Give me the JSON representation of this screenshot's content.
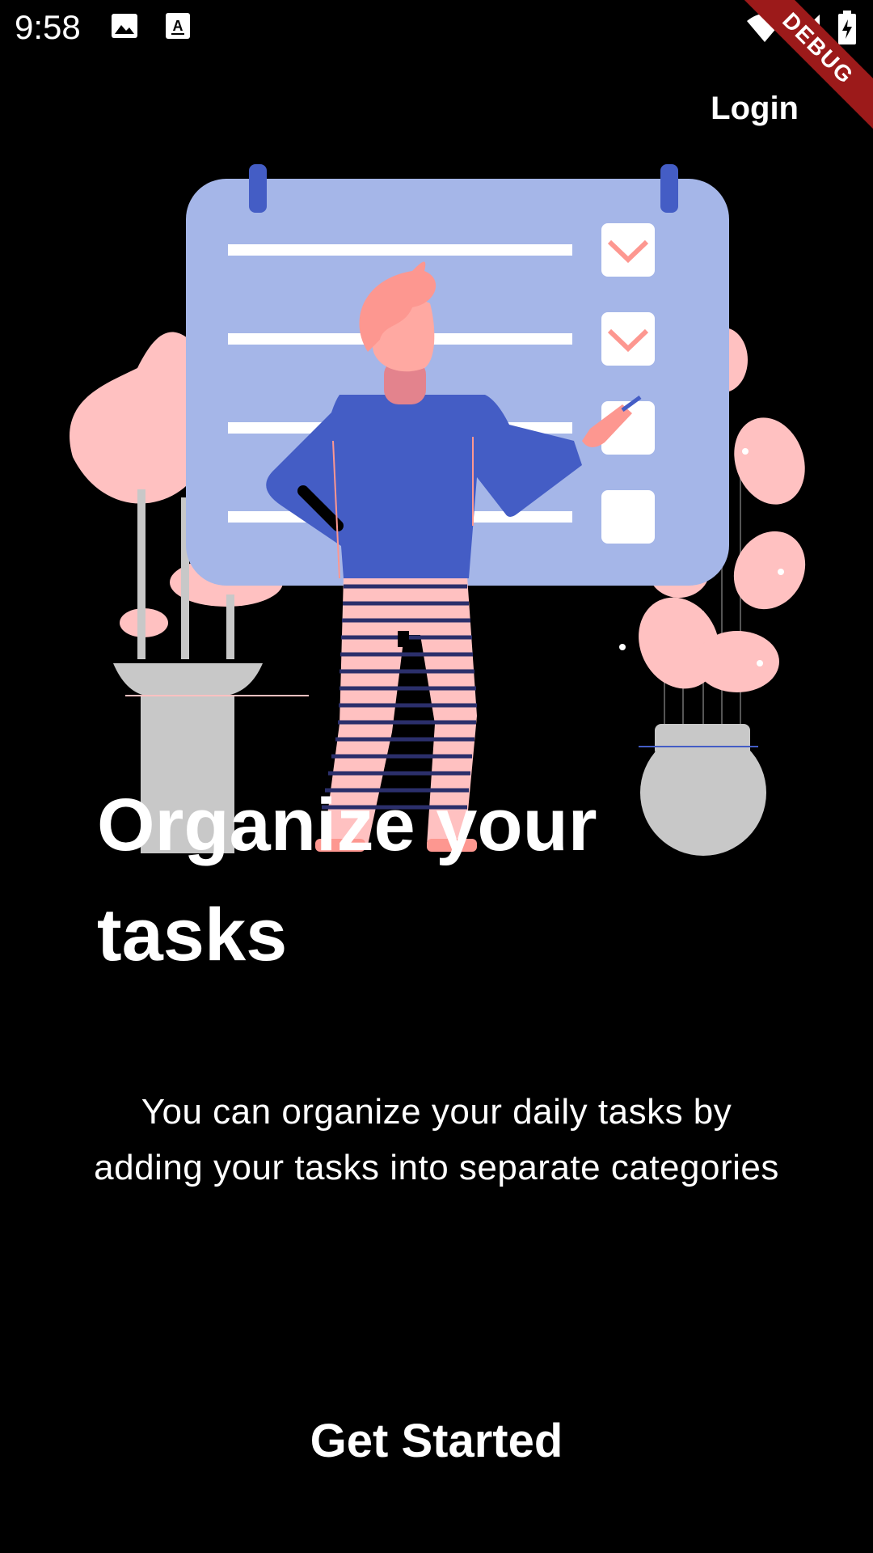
{
  "status_bar": {
    "time": "9:58",
    "icons": [
      "image-icon",
      "text-recognition-icon",
      "wifi-icon",
      "signal-icon",
      "battery-charging-icon"
    ]
  },
  "debug_banner": {
    "label": "DEBUG"
  },
  "header": {
    "login_label": "Login"
  },
  "illustration": {
    "icon": "task-checklist-illustration",
    "colors": {
      "board": "#a5b6e8",
      "board_accent": "#445dc5",
      "pink": "#ffc1c1",
      "salmon": "#fd9790",
      "pot": "#c8c8c8"
    }
  },
  "onboarding": {
    "title": "Organize your tasks",
    "description": "You can organize your daily tasks by adding your tasks into separate categories",
    "cta_label": "Get Started"
  }
}
